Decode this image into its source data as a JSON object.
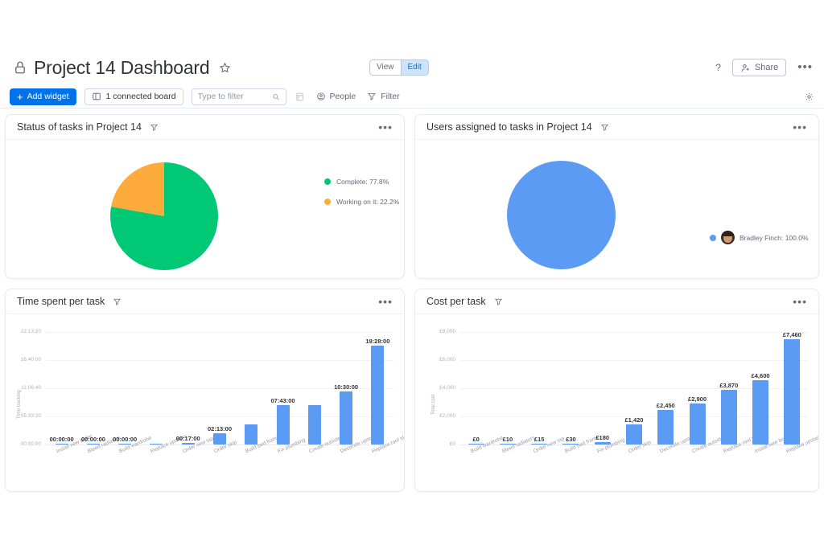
{
  "header": {
    "title": "Project 14 Dashboard",
    "lock_icon": "lock-icon",
    "star_icon": "star-icon",
    "view_label": "View",
    "edit_label": "Edit",
    "help_label": "?",
    "share_label": "Share",
    "more_label": "•••"
  },
  "toolbar": {
    "add_widget_label": "Add widget",
    "plus": "+",
    "connected_board_label": "1 connected board",
    "search_placeholder": "Type to filter",
    "search_value": "",
    "people_label": "People",
    "filter_label": "Filter",
    "gear_icon": "gear-icon",
    "board_icon": "board-icon",
    "sort_icon": "sort-icon"
  },
  "widgets": {
    "status": {
      "title": "Status of tasks in Project 14",
      "menu": "•••"
    },
    "users": {
      "title": "Users assigned to tasks in Project 14",
      "menu": "•••"
    },
    "time": {
      "title": "Time spent per task",
      "menu": "•••"
    },
    "cost": {
      "title": "Cost per task",
      "menu": "•••"
    }
  },
  "chart_data": [
    {
      "id": "status_pie",
      "type": "pie",
      "title": "Status of tasks in Project 14",
      "legend_position": "right",
      "categories": [
        "Complete",
        "Working on it"
      ],
      "values": [
        77.8,
        22.2
      ],
      "colors": [
        "#00c875",
        "#fdab3d"
      ],
      "legend": [
        "Complete: 77.8%",
        "Working on it: 22.2%"
      ]
    },
    {
      "id": "users_pie",
      "type": "pie",
      "title": "Users assigned to tasks in Project 14",
      "legend_position": "right",
      "categories": [
        "Bradley Finch"
      ],
      "values": [
        100.0
      ],
      "colors": [
        "#5b9bf3"
      ],
      "legend": [
        "Bradley Finch: 100.0%"
      ]
    },
    {
      "id": "time_per_task",
      "type": "bar",
      "title": "Time spent per task",
      "ylabel": "Time tracking",
      "xlabel": "",
      "grid": true,
      "yticks": [
        "00:00:00",
        "05:33:20",
        "11:06:40",
        "16:40:00",
        "22:13:20"
      ],
      "ylim": [
        0,
        80000
      ],
      "categories": [
        "Install new boiler",
        "Bleed radiators",
        "Build wardrobe",
        "Replace upstairs ...",
        "Order new tap",
        "Order skip",
        "Build bed frame",
        "Fix plumbing",
        "Create outside bar",
        "Decorate upstairs",
        "Replace roof tiles"
      ],
      "value_labels": [
        "00:00:00",
        "00:00:00",
        "00:00:00",
        "",
        "00:17:00",
        "02:13:00",
        "",
        "07:43:00",
        "",
        "10:30:00",
        "19:28:00"
      ],
      "values": [
        0,
        0,
        0,
        0,
        1020,
        7980,
        14400,
        27780,
        27780,
        37800,
        70080
      ]
    },
    {
      "id": "cost_per_task",
      "type": "bar",
      "title": "Cost per task",
      "ylabel": "Total cost",
      "xlabel": "",
      "grid": true,
      "yticks": [
        "£0",
        "£2,000",
        "£4,000",
        "£6,000",
        "£8,000"
      ],
      "ylim": [
        0,
        8000
      ],
      "categories": [
        "Build wardrobe",
        "Bleed radiators",
        "Order new tap",
        "Build bed frame",
        "Fix plumbing",
        "Order skip",
        "Decorate upstairs",
        "Create outside bar",
        "Replace roof tiles",
        "Install new boiler",
        "Replace upstairs ..."
      ],
      "value_labels": [
        "£0",
        "£10",
        "£15",
        "£30",
        "£180",
        "£1,420",
        "£2,450",
        "£2,900",
        "£3,870",
        "£4,600",
        "£7,460"
      ],
      "values": [
        0,
        10,
        15,
        30,
        180,
        1420,
        2450,
        2900,
        3870,
        4600,
        7460
      ]
    }
  ],
  "colors": {
    "accent": "#0073ea",
    "bar": "#5b9bf3",
    "green": "#00c875",
    "orange": "#fdab3d"
  }
}
